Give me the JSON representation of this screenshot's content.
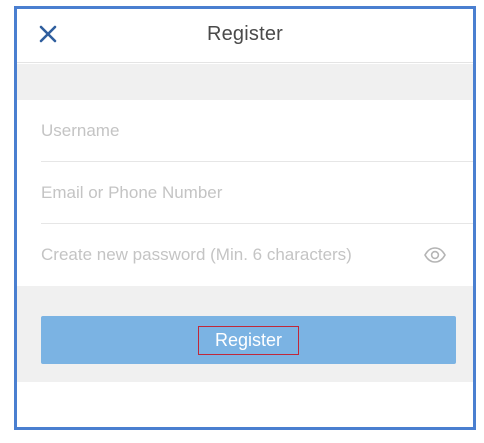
{
  "header": {
    "title": "Register",
    "close_icon": "close-icon"
  },
  "form": {
    "username_placeholder": "Username",
    "contact_placeholder": "Email or Phone Number",
    "password_placeholder": "Create new password (Min. 6 characters)",
    "password_toggle_icon": "eye-icon"
  },
  "actions": {
    "register_label": "Register"
  },
  "colors": {
    "frame_border": "#4a7fd0",
    "button_bg": "#7bb3e3",
    "close_icon": "#2f5e9e",
    "highlight_box": "#c0283a"
  }
}
